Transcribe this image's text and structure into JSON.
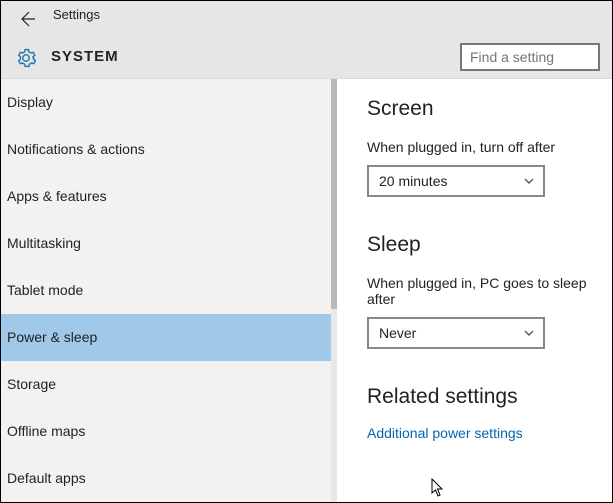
{
  "header": {
    "app_title": "Settings",
    "section_title": "SYSTEM",
    "search_placeholder": "Find a setting"
  },
  "sidebar": {
    "items": [
      {
        "label": "Display"
      },
      {
        "label": "Notifications & actions"
      },
      {
        "label": "Apps & features"
      },
      {
        "label": "Multitasking"
      },
      {
        "label": "Tablet mode"
      },
      {
        "label": "Power & sleep"
      },
      {
        "label": "Storage"
      },
      {
        "label": "Offline maps"
      },
      {
        "label": "Default apps"
      }
    ],
    "selected_index": 5
  },
  "main": {
    "screen": {
      "heading": "Screen",
      "label": "When plugged in, turn off after",
      "value": "20 minutes"
    },
    "sleep": {
      "heading": "Sleep",
      "label": "When plugged in, PC goes to sleep after",
      "value": "Never"
    },
    "related": {
      "heading": "Related settings",
      "link": "Additional power settings"
    }
  }
}
